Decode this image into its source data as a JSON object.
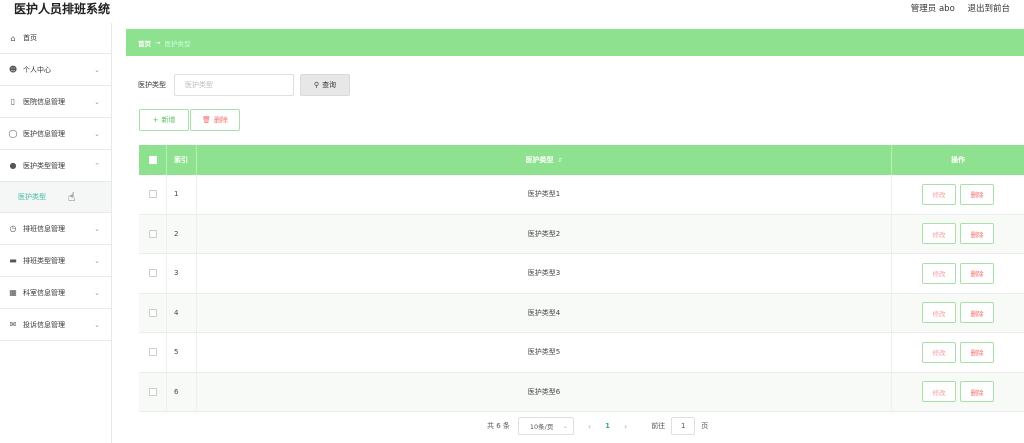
{
  "header": {
    "title": "医护人员排班系统",
    "user": "管理员 abo",
    "exit_label": "退出到前台"
  },
  "sidebar": {
    "items": [
      {
        "label": "首页",
        "icon": "home-icon"
      },
      {
        "label": "个人中心",
        "icon": "user-icon"
      },
      {
        "label": "医院信息管理",
        "icon": "phone-icon"
      },
      {
        "label": "医护信息管理",
        "icon": "mic-icon"
      },
      {
        "label": "医护类型管理",
        "icon": "location-icon"
      },
      {
        "label": "排班信息管理",
        "icon": "clock-icon"
      },
      {
        "label": "排班类型管理",
        "icon": "printer-icon"
      },
      {
        "label": "科室信息管理",
        "icon": "keyboard-icon"
      },
      {
        "label": "投诉信息管理",
        "icon": "mail-icon"
      }
    ],
    "active_sub": "医护类型"
  },
  "breadcrumb": {
    "home": "首页",
    "arrow": "→",
    "current": "医护类型"
  },
  "search": {
    "label": "医护类型",
    "placeholder": "医护类型",
    "button": "查询"
  },
  "actions": {
    "add": "新增",
    "delete": "删除"
  },
  "table": {
    "headers": {
      "index": "索引",
      "type": "医护类型",
      "ops": "操作"
    },
    "rows": [
      {
        "index": "1",
        "type": "医护类型1"
      },
      {
        "index": "2",
        "type": "医护类型2"
      },
      {
        "index": "3",
        "type": "医护类型3"
      },
      {
        "index": "4",
        "type": "医护类型4"
      },
      {
        "index": "5",
        "type": "医护类型5"
      },
      {
        "index": "6",
        "type": "医护类型6"
      }
    ],
    "edit_label": "修改",
    "delete_label": "删除"
  },
  "pagination": {
    "total": "共 6 条",
    "page_size": "10条/页",
    "current_page": "1",
    "goto_label": "前往",
    "goto_value": "1",
    "unit": "页"
  },
  "colors": {
    "accent": "#8ee28f",
    "active_text": "#3fb8a4",
    "danger": "#f56c6c"
  }
}
